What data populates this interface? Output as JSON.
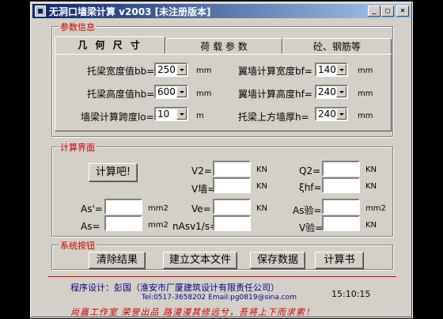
{
  "window": {
    "title": "无洞口墙梁计算 v2003 [未注册版本]",
    "controls": [
      "_",
      "□",
      "×"
    ]
  },
  "params": {
    "group_label": "参数信息",
    "tabs": [
      "几 何 尺 寸",
      "荷 载 参 数",
      "砼、钢筋等"
    ],
    "rows": [
      {
        "label": "托梁宽度值bb=",
        "value": "250",
        "unit": "mm"
      },
      {
        "label": "托梁高度值hb=",
        "value": "600",
        "unit": "mm"
      },
      {
        "label": "墙梁计算跨度lo=",
        "value": "10",
        "unit": "m"
      },
      {
        "label": "翼墙计算宽度bf=",
        "value": "1400",
        "unit": "mm"
      },
      {
        "label": "翼墙计算高度hf=",
        "value": "240",
        "unit": "mm"
      },
      {
        "label": "托梁上方墙厚h=",
        "value": "240",
        "unit": "mm"
      }
    ]
  },
  "calc": {
    "group_label": "计算界面",
    "button": "计算吧!",
    "outputs": [
      {
        "label": "V2=",
        "value": "",
        "unit": "KN"
      },
      {
        "label": "V墙=",
        "value": "",
        "unit": "KN"
      },
      {
        "label": "Q2=",
        "value": "",
        "unit": "KN"
      },
      {
        "label": "ξhf=",
        "value": "",
        "unit": "KN"
      },
      {
        "label": "As'=",
        "value": "",
        "unit": "mm2"
      },
      {
        "label": "As=",
        "value": "",
        "unit": "mm2"
      },
      {
        "label": "Ve=",
        "value": "",
        "unit": "KN"
      },
      {
        "label": "nAsv1/s=",
        "value": "",
        "unit": ""
      },
      {
        "label": "As验=",
        "value": "",
        "unit": "mm2"
      },
      {
        "label": "V验=",
        "value": "",
        "unit": "KN"
      }
    ]
  },
  "system": {
    "group_label": "系统按钮",
    "buttons": [
      "清除结果",
      "建立文本文件",
      "保存数据",
      "计算书"
    ]
  },
  "footer": {
    "designer": "程序设计：彭国（淮安市厂厦建筑设计有限责任公司）",
    "contact": "Tel:0517-3658202    Email:pg0819@sina.com",
    "time": "15:10:15",
    "slogan": "尚嘉工作室 荣誉出品    路漫漫其修远兮，吾将上下而求索！"
  },
  "colors": {
    "titlebar_start": "#0a246a",
    "group_label": "#cc0000",
    "footer_text": "#00008b"
  }
}
